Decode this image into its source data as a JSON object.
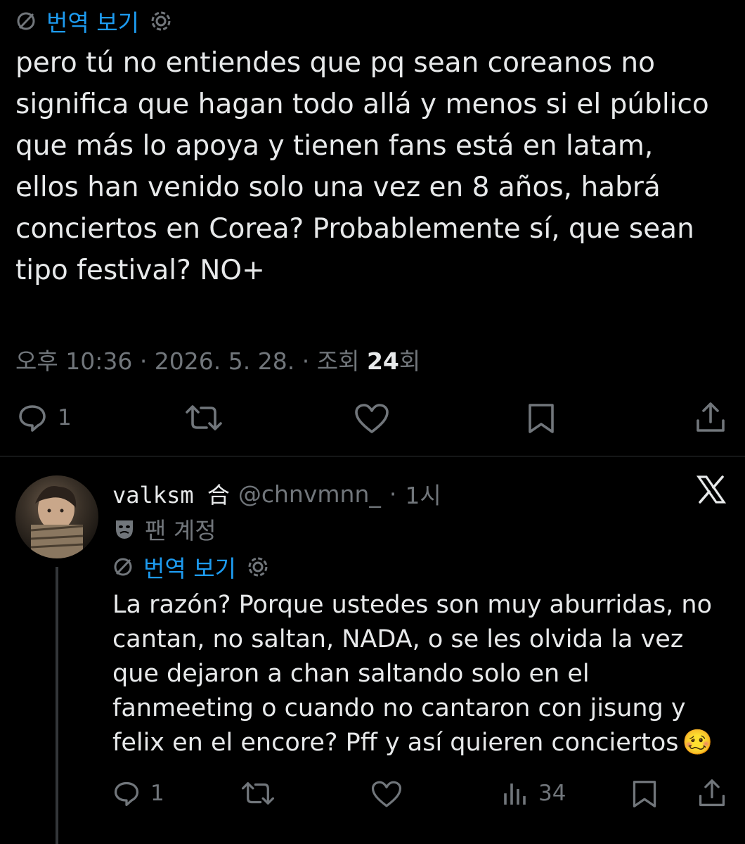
{
  "tweet": {
    "translate_label": "번역 보기",
    "text": "pero tú no entiendes que pq sean coreanos no\nsignifica que hagan todo allá y menos si el público\nque más lo apoya y tienen fans está en latam,\nellos han venido solo una vez en 8 años, habrá\nconciertos en Corea? Probablemente sí, que sean\ntipo festival? NO+",
    "time": "오후 10:36",
    "date": "2026. 5. 28.",
    "views_prefix": "조회",
    "views_count": "24",
    "views_suffix": "회",
    "reply_count": "1"
  },
  "reply": {
    "display_name": "valksm 合",
    "handle": "@chnvmnn_",
    "age": "1시",
    "fan_label": "팬 계정",
    "translate_label": "번역 보기",
    "text": "La razón? Porque ustedes son muy aburridas, no\ncantan, no saltan, NADA, o se les olvida la vez\nque dejaron a chan saltando solo en el\nfanmeeting o cuando no cantaron con jisung y\nfelix en el encore? Pff y así quieren conciertos",
    "emoji": "🥴",
    "reply_count": "1",
    "views_count": "34"
  },
  "colors": {
    "background": "#000000",
    "text": "#e7e9ea",
    "muted": "#71767b",
    "link": "#1d9bf0",
    "divider": "#2f3336"
  },
  "icons": [
    "translate-off-icon",
    "gear-icon",
    "reply-icon",
    "retweet-icon",
    "like-icon",
    "bookmark-icon",
    "share-icon",
    "x-logo-icon",
    "mask-icon",
    "views-icon"
  ]
}
